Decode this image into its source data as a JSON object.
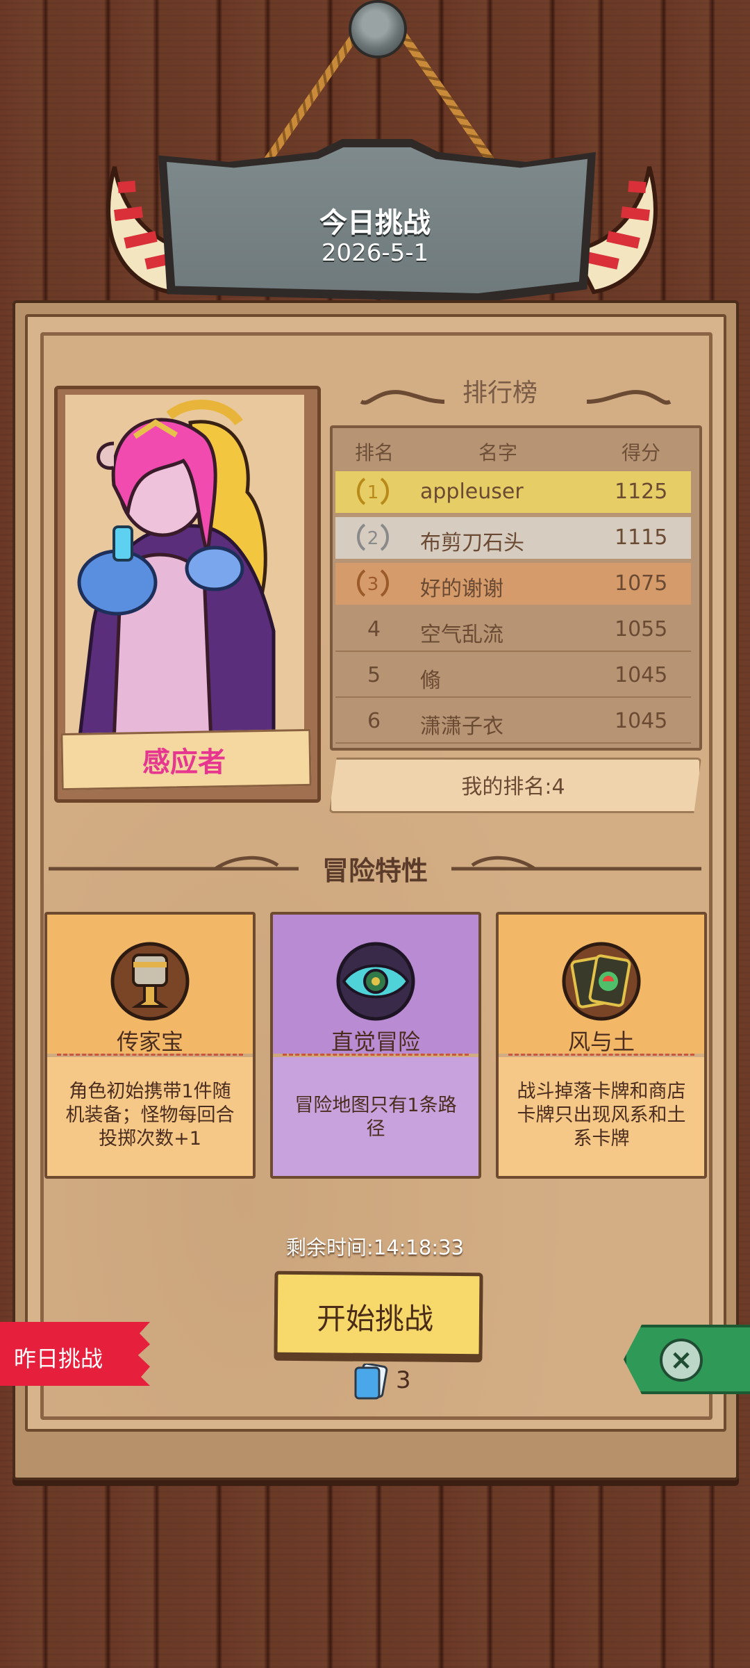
{
  "header": {
    "title": "今日挑战",
    "date": "2026-5-1"
  },
  "character": {
    "name": "感应者"
  },
  "leaderboard": {
    "title": "排行榜",
    "columns": [
      "排名",
      "名字",
      "得分"
    ],
    "rows": [
      {
        "rank": "1",
        "name": "appleuser",
        "score": "1125",
        "color": "#e7cd66"
      },
      {
        "rank": "2",
        "name": "布剪刀石头",
        "score": "1115",
        "color": "#d7ccc0"
      },
      {
        "rank": "3",
        "name": "好的谢谢",
        "score": "1075",
        "color": "#d69b6a"
      },
      {
        "rank": "4",
        "name": "空气乱流",
        "score": "1055"
      },
      {
        "rank": "5",
        "name": "翛",
        "score": "1045"
      },
      {
        "rank": "6",
        "name": "潇潇子衣",
        "score": "1045"
      }
    ],
    "my_rank": "我的排名:4"
  },
  "traits": {
    "title": "冒险特性",
    "cards": [
      {
        "name": "传家宝",
        "desc": "角色初始携带1件随机装备；怪物每回合投掷次数+1",
        "icon": "heirloom-chalice-icon",
        "color": "#f2b868"
      },
      {
        "name": "直觉冒险",
        "desc": "冒险地图只有1条路径",
        "icon": "intuition-eye-icon",
        "color": "#b98bd2"
      },
      {
        "name": "风与土",
        "desc": "战斗掉落卡牌和商店卡牌只出现风系和土系卡牌",
        "icon": "wind-earth-cards-icon",
        "color": "#f2b868"
      }
    ]
  },
  "timer": "剩余时间:14:18:33",
  "start_button": "开始挑战",
  "deck_count": "3",
  "yesterday_tab": "昨日挑战"
}
